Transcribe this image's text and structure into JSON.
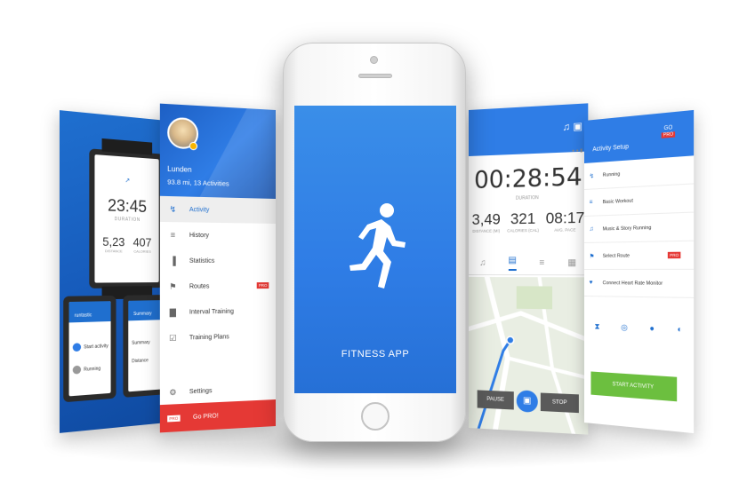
{
  "watch_panel": {
    "brand": "runtastic",
    "time": "23:45",
    "duration_label": "DURATION",
    "distance_value": "5,23",
    "distance_label": "DISTANCE",
    "calories_value": "407",
    "calories_label": "CALORIES",
    "small_watch_1": {
      "header": "runtastic",
      "start": "Start activity",
      "running": "Running"
    },
    "small_watch_2": {
      "header": "Summary",
      "items": [
        "Summary",
        "Distance"
      ]
    }
  },
  "menu_panel": {
    "user_name": "Lunden",
    "user_stats": "93.8 mi, 13 Activities",
    "items": [
      {
        "label": "Activity",
        "icon": "activity-icon",
        "active": true
      },
      {
        "label": "History",
        "icon": "history-icon"
      },
      {
        "label": "Statistics",
        "icon": "statistics-icon"
      },
      {
        "label": "Routes",
        "icon": "routes-icon",
        "badge": "PRO"
      },
      {
        "label": "Interval Training",
        "icon": "interval-training-icon"
      },
      {
        "label": "Training Plans",
        "icon": "training-plans-icon"
      }
    ],
    "settings_label": "Settings",
    "gopro_label": "Go PRO!",
    "gopro_badge": "PRO"
  },
  "phone": {
    "app_title": "FITNESS APP",
    "screen_color": "#2f7de6"
  },
  "timer_panel": {
    "time": "00:28:54",
    "duration_label": "DURATION",
    "stats": [
      {
        "value": "3,49",
        "label": "DISTANCE (MI)"
      },
      {
        "value": "321",
        "label": "CALORIES (CAL)"
      },
      {
        "value": "08:17",
        "label": "AVG. PACE"
      }
    ],
    "pause_label": "PAUSE",
    "stop_label": "STOP"
  },
  "setup_panel": {
    "title": "Activity Setup",
    "go_label": "GO",
    "go_badge": "PRO",
    "items": [
      {
        "label": "Running",
        "icon": "running-icon"
      },
      {
        "label": "Basic Workout",
        "icon": "workout-icon"
      },
      {
        "label": "Music & Story Running",
        "icon": "music-icon"
      },
      {
        "label": "Select Route",
        "icon": "route-icon",
        "badge": "PRO"
      },
      {
        "label": "Connect Heart Rate Monitor",
        "icon": "heart-icon"
      }
    ],
    "start_label": "START ACTIVITY"
  },
  "colors": {
    "accent_blue": "#2f7de6",
    "pro_red": "#e53935",
    "start_green": "#6cbf3f"
  }
}
